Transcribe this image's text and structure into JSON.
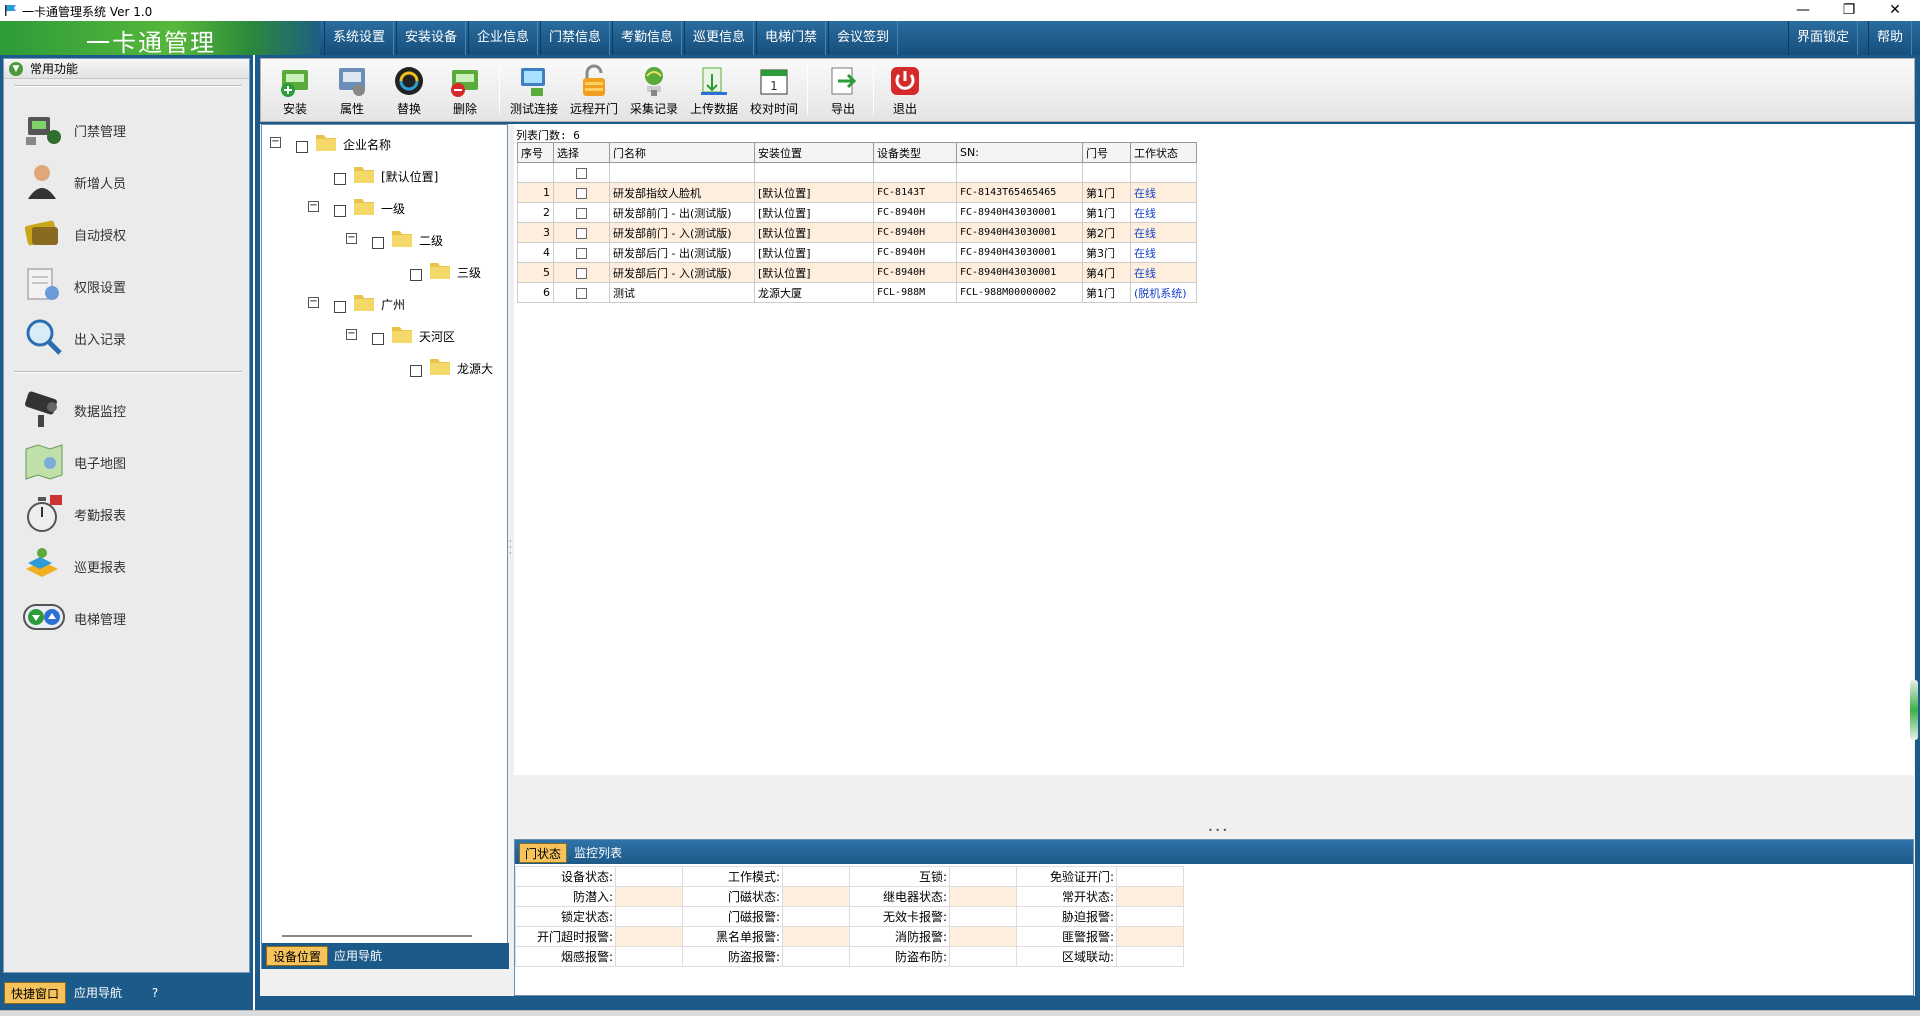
{
  "window": {
    "title": "一卡通管理系统  Ver 1.0",
    "controls": [
      "—",
      "❐",
      "✕"
    ]
  },
  "menubar": {
    "brand": "一卡通管理",
    "items": [
      "系统设置",
      "安装设备",
      "企业信息",
      "门禁信息",
      "考勤信息",
      "巡更信息",
      "电梯门禁",
      "会议签到"
    ],
    "right_items": [
      "界面锁定",
      "帮助"
    ]
  },
  "quick": {
    "header": "常用功能",
    "group1": [
      "门禁管理",
      "新增人员",
      "自动授权",
      "权限设置",
      "出入记录"
    ],
    "group2": [
      "数据监控",
      "电子地图",
      "考勤报表",
      "巡更报表",
      "电梯管理"
    ],
    "tabs": [
      "快捷窗口",
      "应用导航"
    ],
    "help_icon": "?"
  },
  "toolbar": {
    "items": [
      "安装",
      "属性",
      "替换",
      "删除",
      "测试连接",
      "远程开门",
      "采集记录",
      "上传数据",
      "校对时间",
      "导出",
      "退出"
    ]
  },
  "tree": {
    "root": "企业名称",
    "nodes": [
      "[默认位置]",
      "一级",
      "二级",
      "三级",
      "广州",
      "天河区",
      "龙源大"
    ],
    "tabs": [
      "设备位置",
      "应用导航"
    ]
  },
  "grid": {
    "count_label": "列表门数: 6",
    "columns": [
      "序号",
      "选择",
      "门名称",
      "安装位置",
      "设备类型",
      "SN:",
      "门号",
      "工作状态"
    ],
    "rows": [
      {
        "no": "1",
        "name": "研发部指纹人脸机",
        "location": "[默认位置]",
        "type": "FC-8143T",
        "sn": "FC-8143T65465465",
        "door": "第1门",
        "status": "在线"
      },
      {
        "no": "2",
        "name": "研发部前门 - 出(测试版)",
        "location": "[默认位置]",
        "type": "FC-8940H",
        "sn": "FC-8940H43030001",
        "door": "第1门",
        "status": "在线"
      },
      {
        "no": "3",
        "name": "研发部前门 - 入(测试版)",
        "location": "[默认位置]",
        "type": "FC-8940H",
        "sn": "FC-8940H43030001",
        "door": "第2门",
        "status": "在线"
      },
      {
        "no": "4",
        "name": "研发部后门 - 出(测试版)",
        "location": "[默认位置]",
        "type": "FC-8940H",
        "sn": "FC-8940H43030001",
        "door": "第3门",
        "status": "在线"
      },
      {
        "no": "5",
        "name": "研发部后门 - 入(测试版)",
        "location": "[默认位置]",
        "type": "FC-8940H",
        "sn": "FC-8940H43030001",
        "door": "第4门",
        "status": "在线"
      },
      {
        "no": "6",
        "name": "测试",
        "location": "龙源大厦",
        "type": "FCL-988M",
        "sn": "FCL-988M00000002",
        "door": "第1门",
        "status": "(脱机系统)"
      }
    ]
  },
  "detail": {
    "tabs": [
      "门状态",
      "监控列表"
    ],
    "labels": [
      [
        "设备状态:",
        "工作模式:",
        "互锁:",
        "免验证开门:"
      ],
      [
        "防潜入:",
        "门磁状态:",
        "继电器状态:",
        "常开状态:"
      ],
      [
        "锁定状态:",
        "门磁报警:",
        "无效卡报警:",
        "胁迫报警:"
      ],
      [
        "开门超时报警:",
        "黑名单报警:",
        "消防报警:",
        "匪警报警:"
      ],
      [
        "烟感报警:",
        "防盗报警:",
        "防盗布防:",
        "区域联动:"
      ]
    ]
  },
  "colors": {
    "frame_blue": "#1c5a8a",
    "tab_active": "#f5c35a",
    "row_alt": "#fdeede",
    "online_link": "#1640c8"
  }
}
